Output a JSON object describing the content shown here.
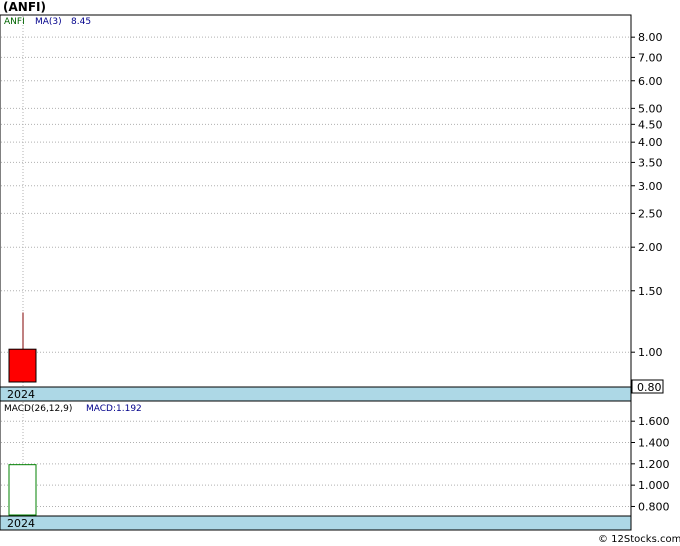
{
  "title": "(ANFI)",
  "price_panel": {
    "legend_symbol": "ANFI",
    "legend_ma_label": "MA(3)",
    "legend_ma_value": "8.45",
    "y_ticks": [
      "8.00",
      "7.00",
      "6.00",
      "5.00",
      "4.50",
      "4.00",
      "3.50",
      "3.00",
      "2.50",
      "2.00",
      "1.50",
      "1.00"
    ],
    "y_tick_values": [
      8,
      7,
      6,
      5,
      4.5,
      4,
      3.5,
      3,
      2.5,
      2,
      1.5,
      1
    ],
    "y_scale": "log",
    "x_label": "2024",
    "last_price_label": "0.80"
  },
  "macd_panel": {
    "legend_params": "MACD(26,12,9)",
    "legend_value": "MACD:1.192",
    "y_ticks": [
      "1.600",
      "1.400",
      "1.200",
      "1.000",
      "0.800"
    ],
    "y_tick_values": [
      1.6,
      1.4,
      1.2,
      1.0,
      0.8
    ],
    "x_label": "2024"
  },
  "footer": "© 12Stocks.com",
  "colors": {
    "candle_down": "#ff0000",
    "wick": "#800000",
    "axis_band": "#add8e6",
    "legend_symbol": "#006400",
    "legend_ma": "#00008b",
    "grid": "#b0b0b0",
    "macd_bar_fill": "#ffffff",
    "macd_bar_stroke": "#008000"
  },
  "chart_data": [
    {
      "type": "candlestick",
      "scale": "log",
      "ylim": [
        0.8,
        9.2
      ],
      "candles": [
        {
          "x": "2024",
          "open": 1.02,
          "close": 0.8,
          "high": 1.3,
          "low": 0.8
        }
      ]
    },
    {
      "type": "bar",
      "categories": [
        "2024"
      ],
      "series": [
        {
          "name": "MACD",
          "values": [
            1.192
          ]
        }
      ],
      "ylim": [
        0.72,
        1.78
      ]
    }
  ]
}
